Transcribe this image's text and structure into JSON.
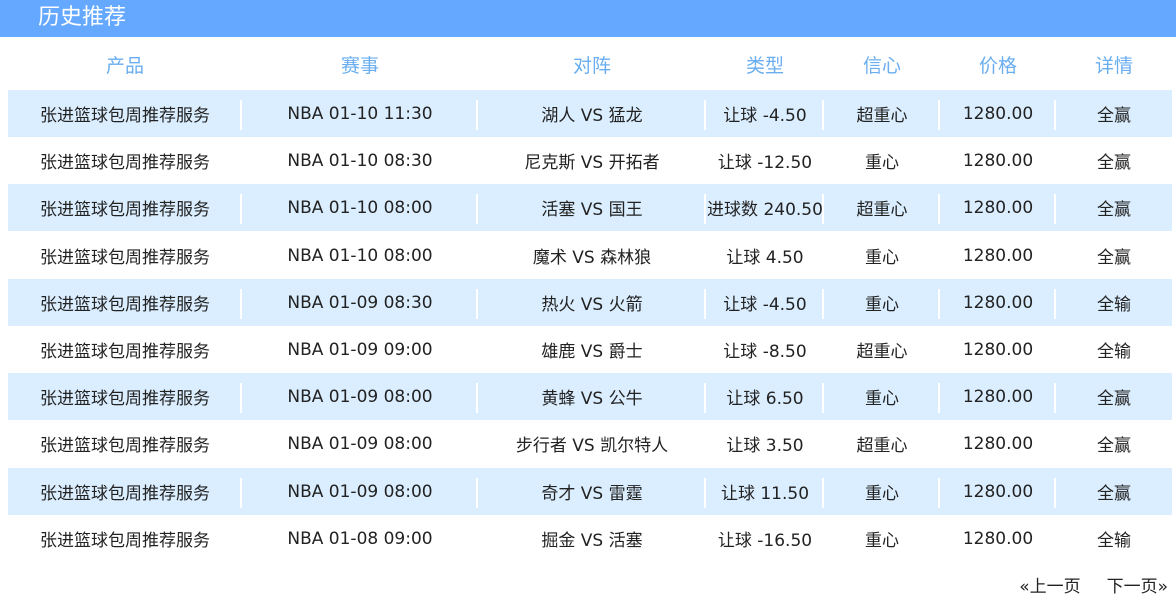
{
  "header": {
    "title": "历史推荐"
  },
  "table": {
    "columns": [
      "产品",
      "赛事",
      "对阵",
      "类型",
      "信心",
      "价格",
      "详情"
    ],
    "rows": [
      {
        "product": "张进篮球包周推荐服务",
        "match": "NBA 01-10 11:30",
        "teams": "湖人 VS 猛龙",
        "type": "让球 -4.50",
        "confidence": "超重心",
        "price": "1280.00",
        "result": "全赢"
      },
      {
        "product": "张进篮球包周推荐服务",
        "match": "NBA 01-10 08:30",
        "teams": "尼克斯 VS 开拓者",
        "type": "让球 -12.50",
        "confidence": "重心",
        "price": "1280.00",
        "result": "全赢"
      },
      {
        "product": "张进篮球包周推荐服务",
        "match": "NBA 01-10 08:00",
        "teams": "活塞 VS 国王",
        "type": "进球数 240.50",
        "confidence": "超重心",
        "price": "1280.00",
        "result": "全赢"
      },
      {
        "product": "张进篮球包周推荐服务",
        "match": "NBA 01-10 08:00",
        "teams": "魔术 VS 森林狼",
        "type": "让球 4.50",
        "confidence": "重心",
        "price": "1280.00",
        "result": "全赢"
      },
      {
        "product": "张进篮球包周推荐服务",
        "match": "NBA 01-09 08:30",
        "teams": "热火 VS 火箭",
        "type": "让球 -4.50",
        "confidence": "重心",
        "price": "1280.00",
        "result": "全输"
      },
      {
        "product": "张进篮球包周推荐服务",
        "match": "NBA 01-09 09:00",
        "teams": "雄鹿 VS 爵士",
        "type": "让球 -8.50",
        "confidence": "超重心",
        "price": "1280.00",
        "result": "全输"
      },
      {
        "product": "张进篮球包周推荐服务",
        "match": "NBA 01-09 08:00",
        "teams": "黄蜂 VS 公牛",
        "type": "让球 6.50",
        "confidence": "重心",
        "price": "1280.00",
        "result": "全赢"
      },
      {
        "product": "张进篮球包周推荐服务",
        "match": "NBA 01-09 08:00",
        "teams": "步行者 VS 凯尔特人",
        "type": "让球 3.50",
        "confidence": "超重心",
        "price": "1280.00",
        "result": "全赢"
      },
      {
        "product": "张进篮球包周推荐服务",
        "match": "NBA 01-09 08:00",
        "teams": "奇才 VS 雷霆",
        "type": "让球 11.50",
        "confidence": "重心",
        "price": "1280.00",
        "result": "全赢"
      },
      {
        "product": "张进篮球包周推荐服务",
        "match": "NBA 01-08 09:00",
        "teams": "掘金 VS 活塞",
        "type": "让球 -16.50",
        "confidence": "重心",
        "price": "1280.00",
        "result": "全输"
      }
    ]
  },
  "pagination": {
    "prev_label": "«上一页",
    "next_label": "下一页»"
  },
  "colors": {
    "title_bar": "#64a9ff",
    "row_stripe": "#dbeeff",
    "header_text": "#6aaef0"
  }
}
